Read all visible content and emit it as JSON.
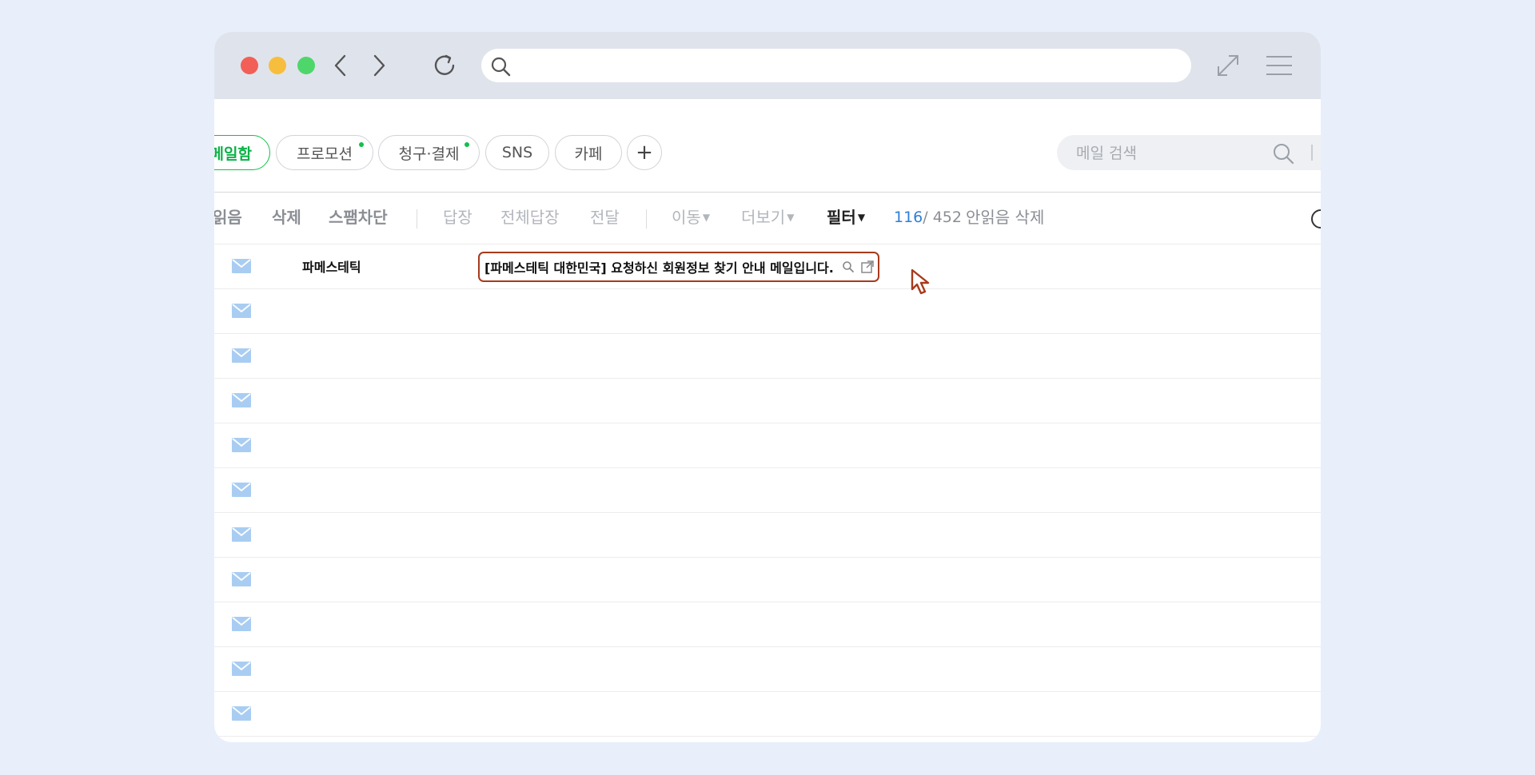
{
  "browser": {
    "address_value": "",
    "icons": [
      "back-icon",
      "forward-icon",
      "reload-icon",
      "search-icon",
      "expand-icon",
      "menu-icon"
    ]
  },
  "folders": [
    {
      "label": "메일함",
      "active": true,
      "dot": false
    },
    {
      "label": "프로모션",
      "active": false,
      "dot": true
    },
    {
      "label": "청구·결제",
      "active": false,
      "dot": true
    },
    {
      "label": "SNS",
      "active": false,
      "dot": false
    },
    {
      "label": "카페",
      "active": false,
      "dot": false
    },
    {
      "label": "+",
      "active": false,
      "dot": false
    }
  ],
  "search": {
    "placeholder": "메일 검색"
  },
  "toolbar": {
    "read": "읽음",
    "delete": "삭제",
    "spam": "스팸차단",
    "reply": "답장",
    "reply_all": "전체답장",
    "forward": "전달",
    "move": "이동",
    "more": "더보기",
    "filter": "필터",
    "unread_count": "116",
    "total_count": "/ 452",
    "delete_unread": "안읽음 삭제"
  },
  "mails": [
    {
      "sender": "파메스테틱",
      "subject": "[파메스테틱 대한민국] 요청하신 회원정보 찾기 안내 메일입니다."
    },
    {
      "sender": "",
      "subject": ""
    },
    {
      "sender": "",
      "subject": ""
    },
    {
      "sender": "",
      "subject": ""
    },
    {
      "sender": "",
      "subject": ""
    },
    {
      "sender": "",
      "subject": ""
    },
    {
      "sender": "",
      "subject": ""
    },
    {
      "sender": "",
      "subject": ""
    },
    {
      "sender": "",
      "subject": ""
    },
    {
      "sender": "",
      "subject": ""
    },
    {
      "sender": "",
      "subject": ""
    },
    {
      "sender": "",
      "subject": ""
    }
  ],
  "colors": {
    "accent_green": "#13c04a",
    "unread_blue": "#2f7fd6",
    "highlight_border": "#a83a1c",
    "envelope": "#a9cdf2"
  }
}
